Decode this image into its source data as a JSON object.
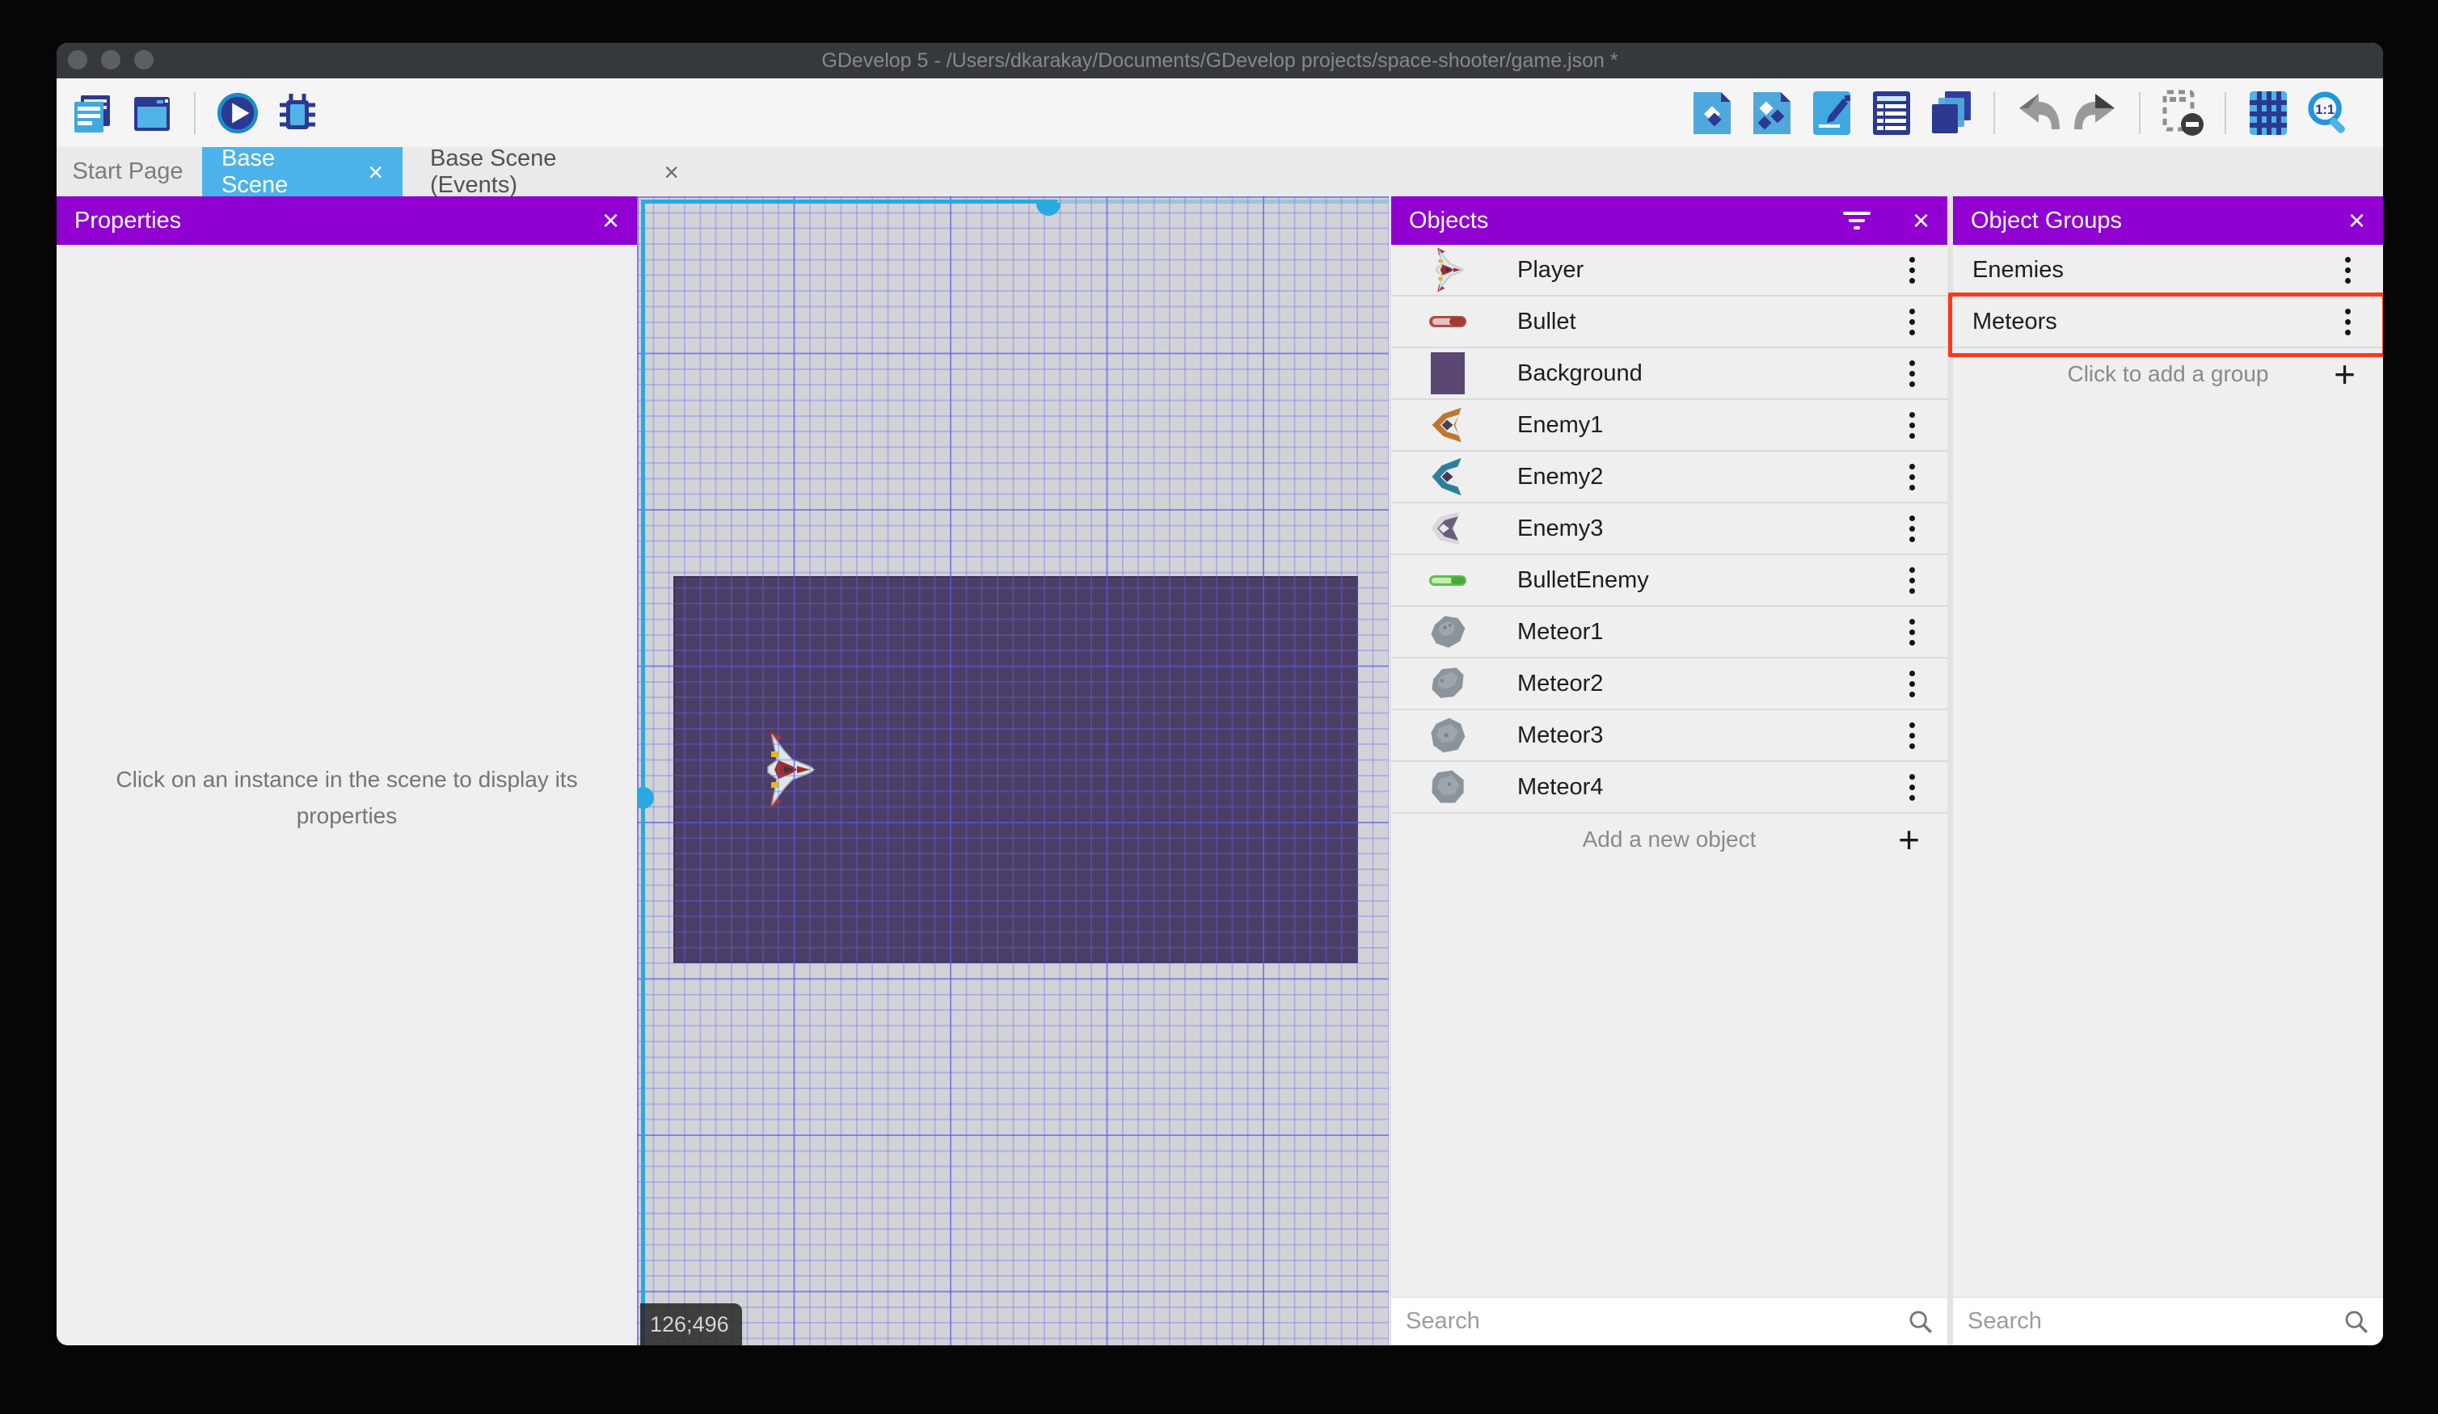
{
  "window": {
    "title": "GDevelop 5 - /Users/dkarakay/Documents/GDevelop projects/space-shooter/game.json *",
    "traffic_lights": [
      "close",
      "minimize",
      "zoom"
    ]
  },
  "toolbar": {
    "left_icons": [
      "project-manager",
      "scene-editor-window",
      "preview-play",
      "debugger-bug"
    ],
    "right_icons": [
      "objects-panel",
      "object-groups-panel",
      "properties-pencil",
      "instances-list",
      "layers",
      "undo",
      "redo",
      "mask-toggle",
      "grid-toggle",
      "zoom-one-to-one"
    ]
  },
  "tabs": [
    {
      "label": "Start Page",
      "active": false,
      "closable": false
    },
    {
      "label": "Base Scene",
      "active": true,
      "closable": true
    },
    {
      "label": "Base Scene (Events)",
      "active": false,
      "closable": true
    }
  ],
  "properties_panel": {
    "title": "Properties",
    "empty_message": "Click on an instance in the scene to display its properties"
  },
  "canvas": {
    "coordinates": "126;496",
    "selection_color": "#2aa9e0",
    "scene_background_color": "#4b3d66"
  },
  "objects_panel": {
    "title": "Objects",
    "items": [
      {
        "label": "Player",
        "icon": "player-ship-icon"
      },
      {
        "label": "Bullet",
        "icon": "red-bullet-icon"
      },
      {
        "label": "Background",
        "icon": "purple-background-icon"
      },
      {
        "label": "Enemy1",
        "icon": "orange-enemy-ship-icon"
      },
      {
        "label": "Enemy2",
        "icon": "teal-enemy-ship-icon"
      },
      {
        "label": "Enemy3",
        "icon": "gray-enemy-ship-icon"
      },
      {
        "label": "BulletEnemy",
        "icon": "green-bullet-icon"
      },
      {
        "label": "Meteor1",
        "icon": "meteor-icon"
      },
      {
        "label": "Meteor2",
        "icon": "meteor-icon"
      },
      {
        "label": "Meteor3",
        "icon": "meteor-icon"
      },
      {
        "label": "Meteor4",
        "icon": "meteor-icon"
      }
    ],
    "add_label": "Add a new object",
    "search_placeholder": "Search"
  },
  "groups_panel": {
    "title": "Object Groups",
    "items": [
      {
        "label": "Enemies",
        "highlighted": false
      },
      {
        "label": "Meteors",
        "highlighted": true
      }
    ],
    "add_label": "Click to add a group",
    "search_placeholder": "Search",
    "annotation_color": "#fb3a1d"
  },
  "theme": {
    "panel_header_color": "#8f00d1",
    "active_tab_color": "#4cb3ea"
  }
}
